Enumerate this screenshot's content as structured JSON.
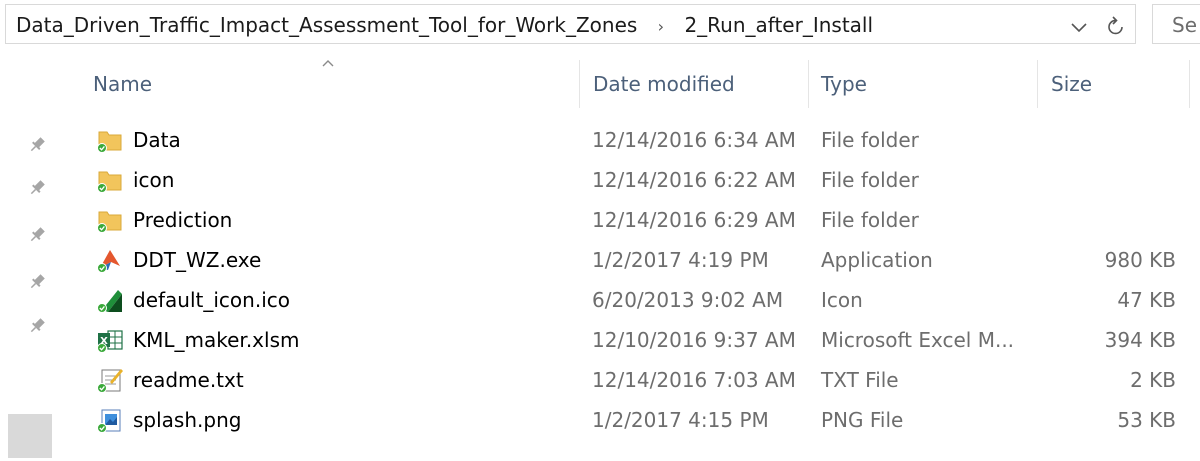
{
  "address": {
    "crumbs": [
      "Data_Driven_Traffic_Impact_Assessment_Tool_for_Work_Zones",
      "2_Run_after_Install"
    ],
    "search_placeholder": "Se"
  },
  "columns": {
    "name": "Name",
    "date": "Date modified",
    "type": "Type",
    "size": "Size"
  },
  "files": [
    {
      "name": "Data",
      "date": "12/14/2016 6:34 AM",
      "type": "File folder",
      "size": "",
      "icon": "folder-icon"
    },
    {
      "name": "icon",
      "date": "12/14/2016 6:22 AM",
      "type": "File folder",
      "size": "",
      "icon": "folder-icon"
    },
    {
      "name": "Prediction",
      "date": "12/14/2016 6:29 AM",
      "type": "File folder",
      "size": "",
      "icon": "folder-icon"
    },
    {
      "name": "DDT_WZ.exe",
      "date": "1/2/2017 4:19 PM",
      "type": "Application",
      "size": "980 KB",
      "icon": "application-icon"
    },
    {
      "name": "default_icon.ico",
      "date": "6/20/2013 9:02 AM",
      "type": "Icon",
      "size": "47 KB",
      "icon": "ico-file-icon"
    },
    {
      "name": "KML_maker.xlsm",
      "date": "12/10/2016 9:37 AM",
      "type": "Microsoft Excel M...",
      "size": "394 KB",
      "icon": "excel-file-icon"
    },
    {
      "name": "readme.txt",
      "date": "12/14/2016 7:03 AM",
      "type": "TXT File",
      "size": "2 KB",
      "icon": "text-file-icon"
    },
    {
      "name": "splash.png",
      "date": "1/2/2017 4:15 PM",
      "type": "PNG File",
      "size": "53 KB",
      "icon": "image-file-icon"
    }
  ],
  "colors": {
    "header_text": "#4c607a",
    "secondary_text": "#6d6d6d",
    "folder": "#f2c55c",
    "sync_badge": "#3aa93a"
  }
}
